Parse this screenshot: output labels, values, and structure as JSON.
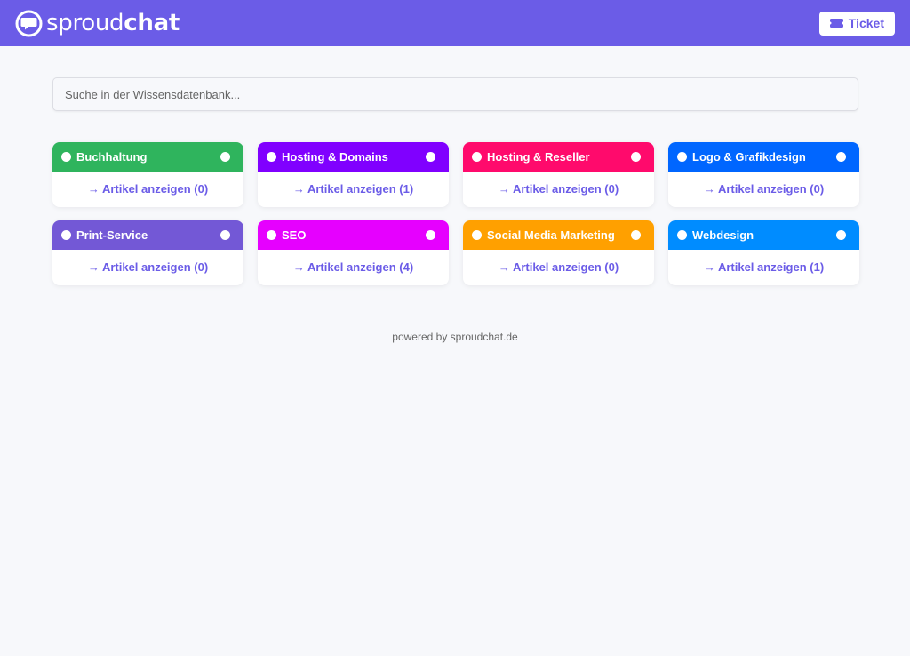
{
  "header": {
    "brand_light": "sproud",
    "brand_bold": "chat",
    "ticket_label": "Ticket",
    "logo_icon": "chat-bubble-logo-icon",
    "ticket_icon": "ticket-icon",
    "background_color": "#6b5ce7"
  },
  "search": {
    "placeholder": "Suche in der Wissensdatenbank...",
    "value": ""
  },
  "categories": [
    {
      "title": "Buchhaltung",
      "link": "→ Artikel anzeigen (0)",
      "color": "#2fb45d"
    },
    {
      "title": "Hosting & Domains",
      "link": "→ Artikel anzeigen (1)",
      "color": "#8000ff"
    },
    {
      "title": "Hosting & Reseller",
      "link": "→ Artikel anzeigen (0)",
      "color": "#ff0a6c"
    },
    {
      "title": "Logo & Grafikdesign",
      "link": "→ Artikel anzeigen (0)",
      "color": "#0066ff"
    },
    {
      "title": "Print-Service",
      "link": "→ Artikel anzeigen (0)",
      "color": "#7358d6"
    },
    {
      "title": "SEO",
      "link": "→ Artikel anzeigen (4)",
      "color": "#e600ff"
    },
    {
      "title": "Social Media Marketing",
      "link": "→ Artikel anzeigen (0)",
      "color": "#ffa000"
    },
    {
      "title": "Webdesign",
      "link": "→ Artikel anzeigen (1)",
      "color": "#008cff"
    }
  ],
  "footer": {
    "text": "powered by sproudchat.de"
  }
}
